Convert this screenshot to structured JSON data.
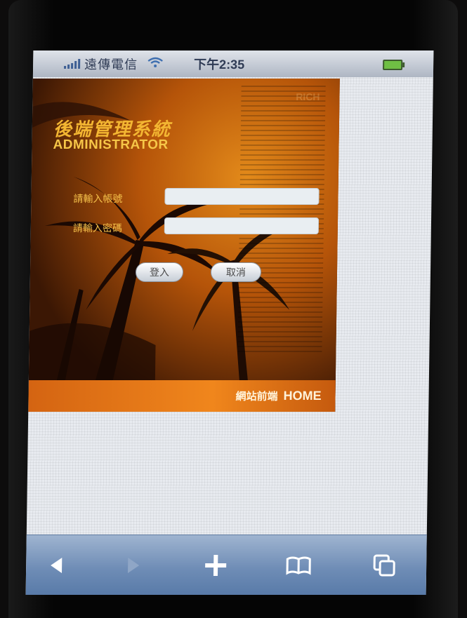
{
  "status_bar": {
    "carrier": "遠傳電信",
    "time": "下午2:35"
  },
  "login": {
    "title_zh": "後端管理系統",
    "title_en": "ADMINISTRATOR",
    "account_label": "請輸入帳號",
    "password_label": "請輸入密碼",
    "account_value": "",
    "password_value": "",
    "login_button": "登入",
    "cancel_button": "取消",
    "footer_zh": "網站前端",
    "footer_en": "HOME",
    "texture_text": "RICH"
  },
  "toolbar": {
    "icons": [
      "back-icon",
      "forward-icon",
      "add-bookmark-icon",
      "bookmarks-icon",
      "pages-icon"
    ]
  },
  "colors": {
    "accent_orange": "#f0861c",
    "title_gold": "#f3b632",
    "toolbar_blue": "#6f8db6"
  }
}
